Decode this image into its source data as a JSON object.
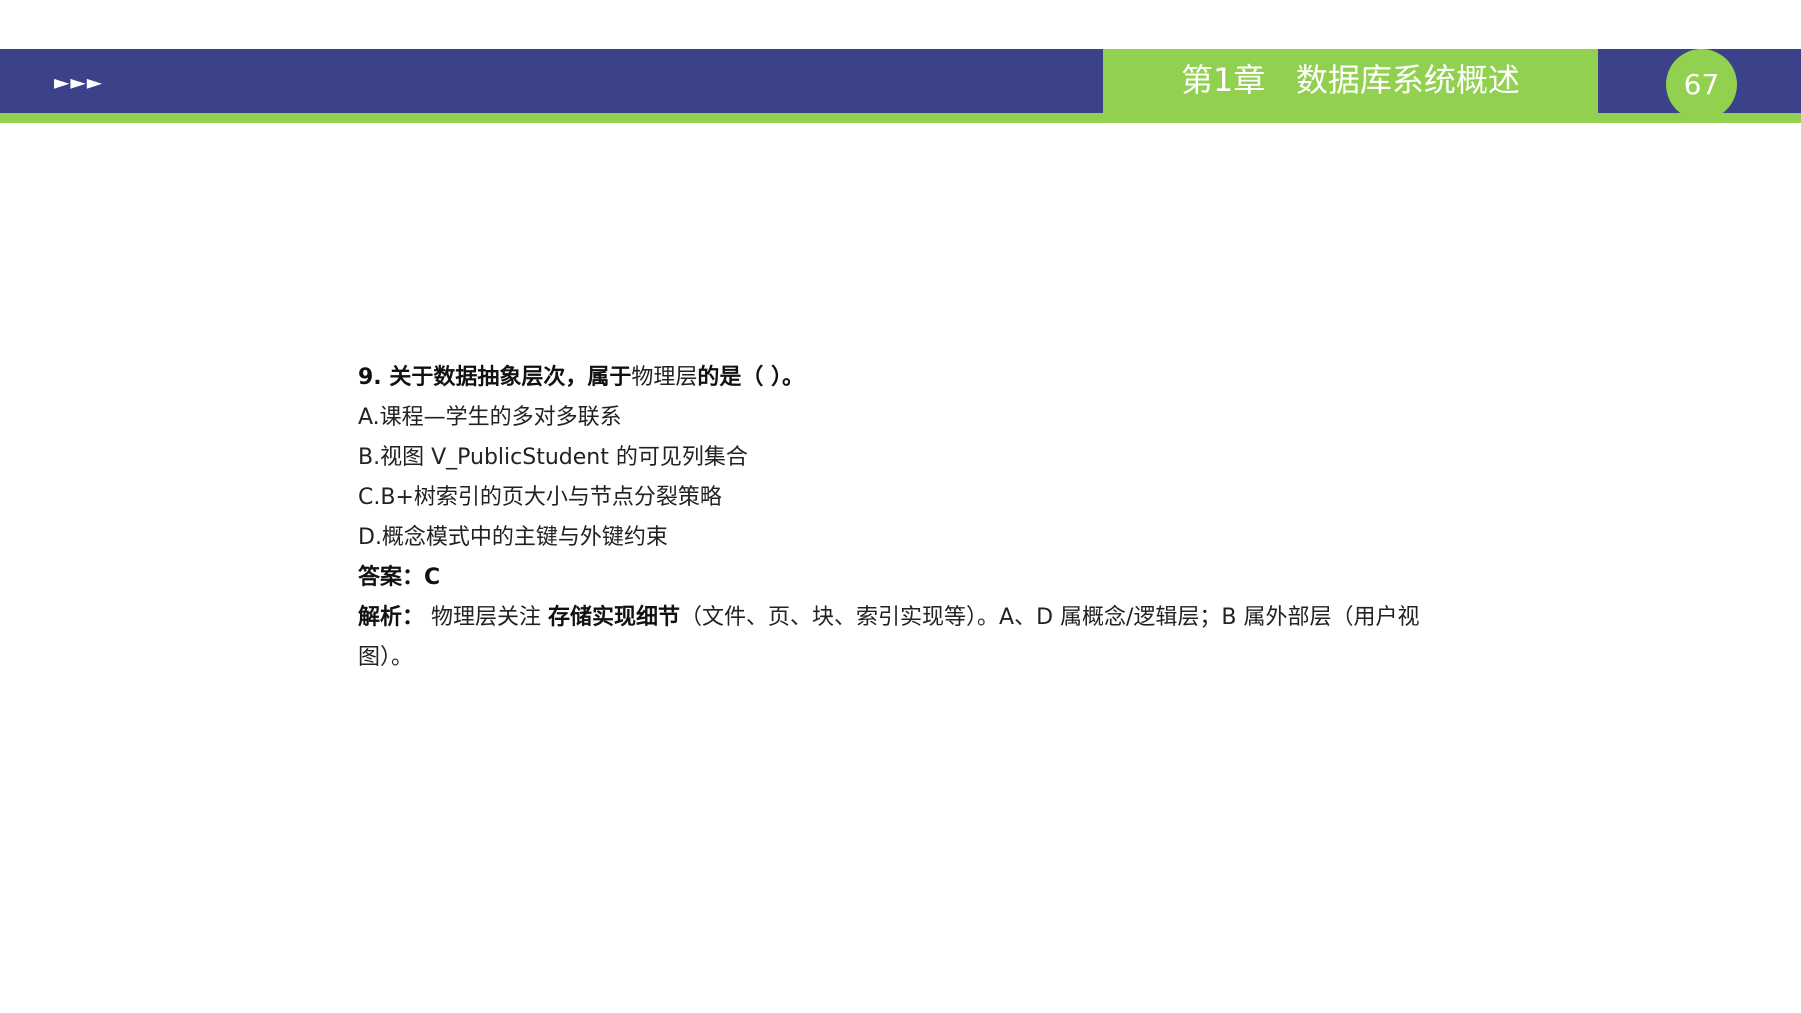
{
  "header": {
    "arrows": "►►►",
    "chapter_title": "第1章   数据库系统概述",
    "page_number": "67"
  },
  "question": {
    "stem_bold_prefix": "9. 关于数据抽象层次，属于",
    "stem_normal": "物理层",
    "stem_bold_suffix": "的是（  ）。",
    "options": [
      "A.课程—学生的多对多联系",
      "B.视图 V_PublicStudent 的可见列集合",
      "C.B+树索引的页大小与节点分裂策略",
      "D.概念模式中的主键与外键约束"
    ],
    "answer_label": "答案：",
    "answer_value": "C",
    "analysis_label": "解析：",
    "analysis_part1": " 物理层关注 ",
    "analysis_bold": "存储实现细节",
    "analysis_part2": "（文件、页、块、索引实现等）。A、D 属概念/逻辑层；B 属外部层（用户视图）。"
  },
  "colors": {
    "header_blue": "#3b4289",
    "accent_green": "#92d050",
    "text": "#222222"
  }
}
